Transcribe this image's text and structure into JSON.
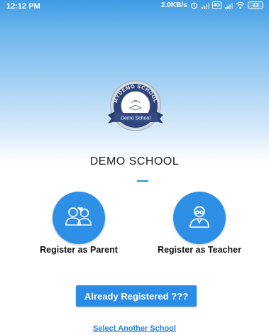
{
  "status_bar": {
    "time": "12:12 PM",
    "network_speed": "2.0KB/s",
    "network_type": "4G",
    "battery_level": "23",
    "icons": [
      "alarm-icon",
      "signal-icon",
      "volte-icon",
      "signal-icon",
      "wifi-icon",
      "battery-icon"
    ]
  },
  "logo": {
    "arc_text": "MYDEMO SCHOOL",
    "ribbon_text": "Demo School"
  },
  "school_name": "DEMO SCHOOL",
  "register_parent": {
    "label": "Register as Parent",
    "icon": "parents-icon"
  },
  "register_teacher": {
    "label": "Register as Teacher",
    "icon": "teacher-icon"
  },
  "already_registered_button": "Already Registered ???",
  "select_school_link": "Select Another School",
  "colors": {
    "accent": "#2d8fe6",
    "link": "#1d7fdd",
    "header_top": "#3f9be4",
    "text": "#111111"
  }
}
